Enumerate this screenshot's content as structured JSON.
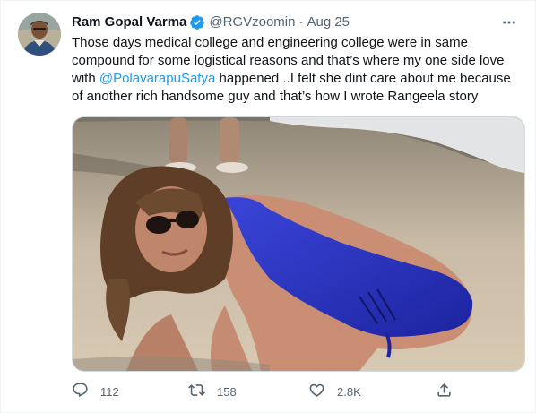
{
  "tweet": {
    "author_name": "Ram Gopal Varma",
    "handle": "@RGVzoomin",
    "separator": "·",
    "date": "Aug 25",
    "text_part1": "Those days medical college and engineering college were in same compound for some logistical reasons and that’s where my one side love with ",
    "mention": "@PolavarapuSatya",
    "text_part2": " happened ..I felt she dint care about me because of another rich handsome guy and that’s how I wrote Rangeela story",
    "icons": {
      "verified": "verified-badge-icon",
      "more": "more-options-icon",
      "reply": "reply-icon",
      "retweet": "retweet-icon",
      "like": "like-icon",
      "share": "share-icon"
    },
    "colors": {
      "text": "#0f1419",
      "secondary": "#536471",
      "accent": "#1d9bf0"
    }
  },
  "actions": {
    "reply_count": "112",
    "retweet_count": "158",
    "like_count": "2.8K"
  }
}
